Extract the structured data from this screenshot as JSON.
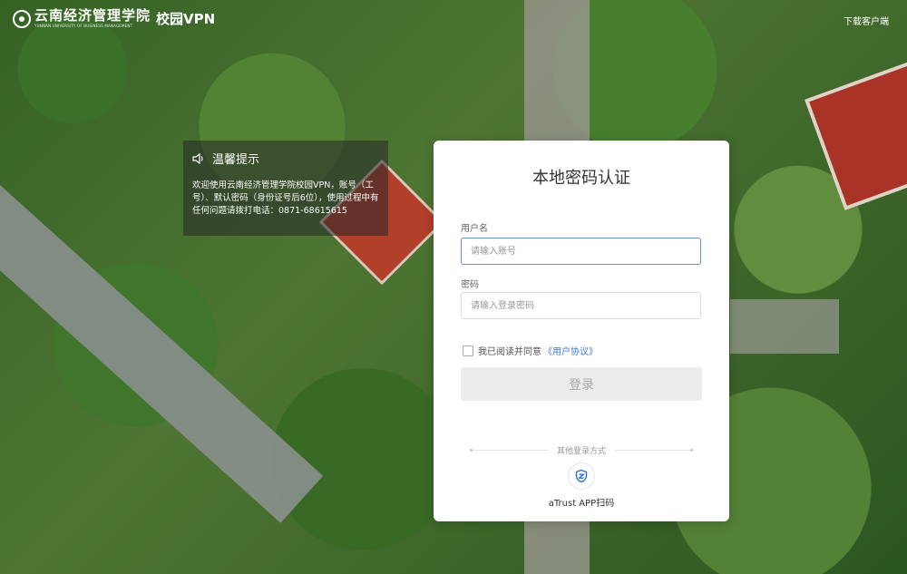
{
  "header": {
    "logo_cn": "云南经济管理学院",
    "logo_en": "YUNNAN UNIVERSITY OF BUSINESS MANAGEMENT",
    "logo_vpn": "校园VPN",
    "download_link": "下载客户端"
  },
  "notice": {
    "title": "温馨提示",
    "body": "欢迎使用云南经济管理学院校园VPN，账号（工号）、默认密码（身份证号后6位），使用过程中有任何问题请拨打电话：0871-68615615"
  },
  "login": {
    "title": "本地密码认证",
    "username_label": "用户名",
    "username_placeholder": "请输入账号",
    "username_value": "",
    "password_label": "密码",
    "password_placeholder": "请输入登录密码",
    "password_value": "",
    "agree_text": "我已阅读并同意",
    "agreement_link": "《用户协议》",
    "agree_checked": false,
    "submit_label": "登录",
    "other_methods": "其他登录方式",
    "atrust_label": "aTrust APP扫码"
  },
  "colors": {
    "accent": "#3b78d6",
    "focus_border": "#6a8fd8",
    "disabled_button": "#ececec"
  }
}
